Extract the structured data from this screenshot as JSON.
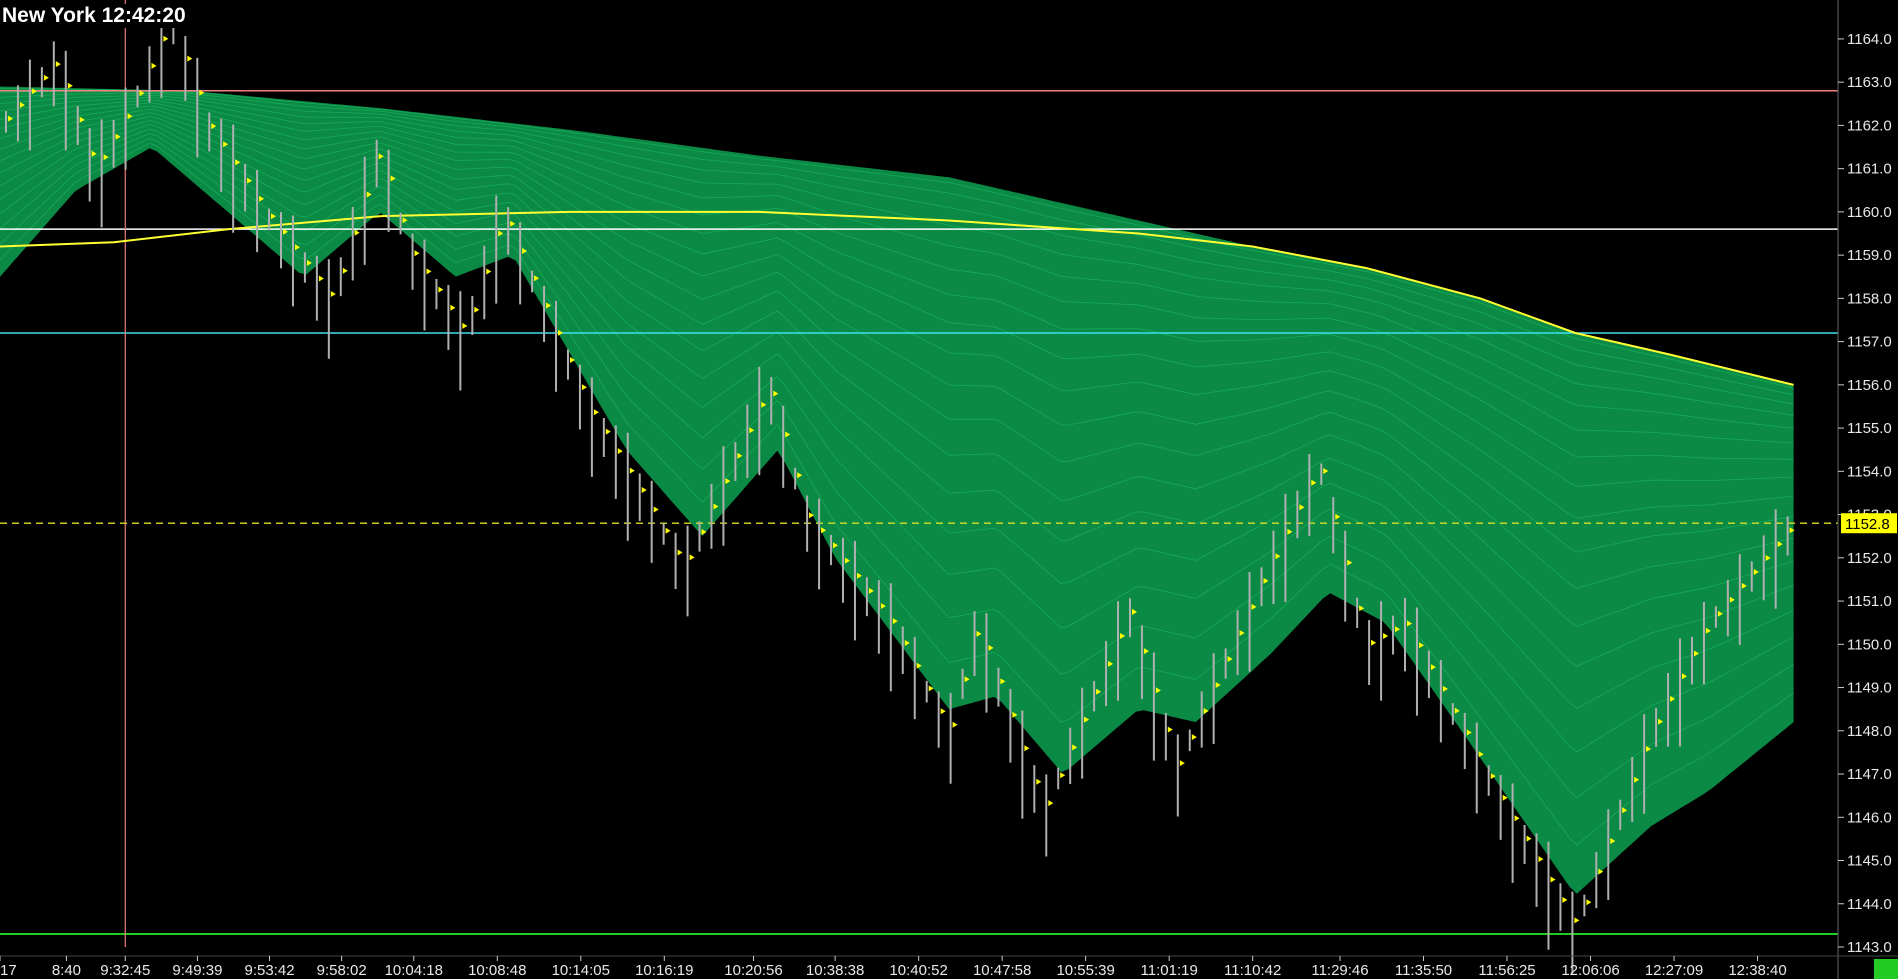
{
  "header": {
    "clock_label": "New York 12:42:20"
  },
  "colors": {
    "background": "#000000",
    "ribbon": "#0a8a45",
    "ribbon_line": "#22c46a",
    "yellow_ma": "#ffff33",
    "red_line": "#f08080",
    "white_line": "#ffffff",
    "cyan_line": "#40e0f0",
    "green_line": "#22cc22",
    "current_price": "#dddd22",
    "candle": "#b0b0b0",
    "marker": "#ffff00"
  },
  "chart_data": {
    "type": "line",
    "ylim": [
      1143.0,
      1164.9
    ],
    "y_ticks": [
      "1143.0",
      "1144.0",
      "1145.0",
      "1146.0",
      "1147.0",
      "1148.0",
      "1149.0",
      "1150.0",
      "1151.0",
      "1152.0",
      "1153.0",
      "1154.0",
      "1155.0",
      "1156.0",
      "1157.0",
      "1158.0",
      "1159.0",
      "1160.0",
      "1161.0",
      "1162.0",
      "1163.0",
      "1164.0"
    ],
    "x_tick_labels": [
      "17",
      "8:40",
      "9:32:45",
      "9:49:39",
      "9:53:42",
      "9:58:02",
      "10:04:18",
      "10:08:48",
      "10:14:05",
      "10:16:19",
      "10:20:56",
      "10:38:38",
      "10:40:52",
      "10:47:58",
      "10:55:39",
      "11:01:19",
      "11:10:42",
      "11:29:46",
      "11:35:50",
      "11:56:25",
      "12:06:06",
      "12:27:09",
      "12:38:40"
    ],
    "x_tick_frac": [
      0.0,
      0.035,
      0.066,
      0.104,
      0.142,
      0.18,
      0.218,
      0.262,
      0.306,
      0.35,
      0.397,
      0.44,
      0.484,
      0.528,
      0.572,
      0.616,
      0.66,
      0.706,
      0.75,
      0.794,
      0.838,
      0.882,
      0.926
    ],
    "horizontal_lines": [
      {
        "value": 1162.8,
        "color": "#f08080"
      },
      {
        "value": 1159.6,
        "color": "#ffffff"
      },
      {
        "value": 1157.2,
        "color": "#40e0f0"
      },
      {
        "value": 1143.3,
        "color": "#22cc22"
      }
    ],
    "current_price": 1152.8,
    "current_price_label": "1152.8",
    "vertical_line_frac": 0.066,
    "price_path": [
      [
        0.0,
        1162.0
      ],
      [
        0.03,
        1163.5
      ],
      [
        0.05,
        1161.0
      ],
      [
        0.07,
        1162.5
      ],
      [
        0.09,
        1164.5
      ],
      [
        0.11,
        1162.0
      ],
      [
        0.14,
        1160.0
      ],
      [
        0.175,
        1158.0
      ],
      [
        0.2,
        1161.5
      ],
      [
        0.215,
        1159.2
      ],
      [
        0.245,
        1157.2
      ],
      [
        0.265,
        1160.0
      ],
      [
        0.31,
        1155.5
      ],
      [
        0.345,
        1153.0
      ],
      [
        0.36,
        1151.8
      ],
      [
        0.405,
        1156.0
      ],
      [
        0.425,
        1153.0
      ],
      [
        0.47,
        1150.5
      ],
      [
        0.5,
        1148.0
      ],
      [
        0.515,
        1150.5
      ],
      [
        0.55,
        1146.2
      ],
      [
        0.595,
        1150.8
      ],
      [
        0.62,
        1147.2
      ],
      [
        0.665,
        1151.5
      ],
      [
        0.695,
        1154.2
      ],
      [
        0.72,
        1150.0
      ],
      [
        0.74,
        1150.5
      ],
      [
        0.79,
        1146.5
      ],
      [
        0.83,
        1143.5
      ],
      [
        0.87,
        1148.0
      ],
      [
        0.9,
        1150.5
      ],
      [
        0.945,
        1152.8
      ]
    ],
    "yellow_ma": [
      [
        0.0,
        1159.2
      ],
      [
        0.06,
        1159.3
      ],
      [
        0.12,
        1159.6
      ],
      [
        0.2,
        1159.9
      ],
      [
        0.3,
        1160.0
      ],
      [
        0.4,
        1160.0
      ],
      [
        0.5,
        1159.8
      ],
      [
        0.6,
        1159.5
      ],
      [
        0.66,
        1159.2
      ],
      [
        0.72,
        1158.7
      ],
      [
        0.78,
        1158.0
      ],
      [
        0.83,
        1157.2
      ],
      [
        0.88,
        1156.7
      ],
      [
        0.945,
        1156.0
      ]
    ],
    "ribbon_top": [
      [
        0.0,
        1162.9
      ],
      [
        0.1,
        1162.8
      ],
      [
        0.2,
        1162.4
      ],
      [
        0.3,
        1161.9
      ],
      [
        0.4,
        1161.3
      ],
      [
        0.5,
        1160.8
      ],
      [
        0.58,
        1160.0
      ],
      [
        0.66,
        1159.2
      ],
      [
        0.72,
        1158.7
      ],
      [
        0.78,
        1158.0
      ],
      [
        0.83,
        1157.2
      ],
      [
        0.88,
        1156.7
      ],
      [
        0.945,
        1156.0
      ]
    ],
    "ribbon_bottom": [
      [
        0.0,
        1158.5
      ],
      [
        0.04,
        1160.5
      ],
      [
        0.08,
        1161.5
      ],
      [
        0.12,
        1160.0
      ],
      [
        0.16,
        1158.5
      ],
      [
        0.2,
        1160.0
      ],
      [
        0.24,
        1158.5
      ],
      [
        0.27,
        1159.0
      ],
      [
        0.33,
        1154.5
      ],
      [
        0.37,
        1152.5
      ],
      [
        0.41,
        1154.5
      ],
      [
        0.44,
        1152.0
      ],
      [
        0.5,
        1148.5
      ],
      [
        0.525,
        1148.8
      ],
      [
        0.56,
        1147.0
      ],
      [
        0.6,
        1148.5
      ],
      [
        0.63,
        1148.2
      ],
      [
        0.67,
        1149.8
      ],
      [
        0.7,
        1151.2
      ],
      [
        0.73,
        1150.5
      ],
      [
        0.77,
        1148.0
      ],
      [
        0.83,
        1144.2
      ],
      [
        0.87,
        1145.8
      ],
      [
        0.9,
        1146.6
      ],
      [
        0.945,
        1148.2
      ]
    ]
  }
}
